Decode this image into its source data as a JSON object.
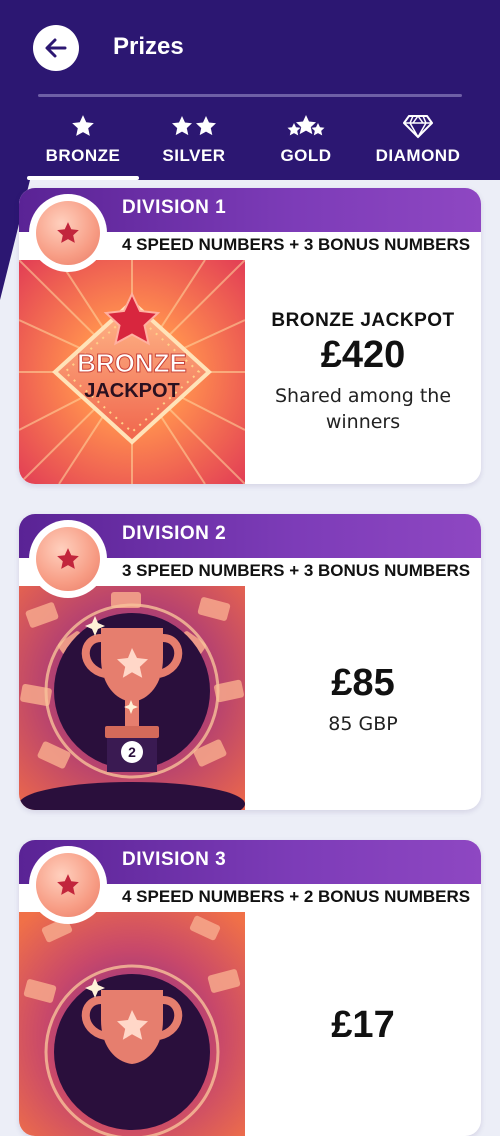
{
  "header": {
    "title": "Prizes"
  },
  "tabs": [
    {
      "label": "BRONZE",
      "icon": "one-star-icon",
      "selected": true
    },
    {
      "label": "SILVER",
      "icon": "two-stars-icon",
      "selected": false
    },
    {
      "label": "GOLD",
      "icon": "three-stars-icon",
      "selected": false
    },
    {
      "label": "DIAMOND",
      "icon": "diamond-icon",
      "selected": false
    }
  ],
  "divisions": [
    {
      "title": "DIVISION 1",
      "requirement": "4 SPEED NUMBERS + 3 BONUS NUMBERS",
      "image_text_line1": "BRONZE",
      "image_text_line2": "JACKPOT",
      "prize_name": "BRONZE JACKPOT",
      "amount": "£420",
      "subtitle": "Shared among the winners"
    },
    {
      "title": "DIVISION 2",
      "requirement": "3 SPEED NUMBERS + 3 BONUS NUMBERS",
      "trophy_number": "2",
      "amount": "£85",
      "subtitle": "85 GBP"
    },
    {
      "title": "DIVISION 3",
      "requirement": "4 SPEED NUMBERS + 2 BONUS NUMBERS",
      "amount": "£17"
    }
  ],
  "colors": {
    "header_bg": "#2C1772",
    "division_bar": "#6A2DA8",
    "page_bg": "#ECEEF7",
    "badge_star": "#C2253C"
  }
}
